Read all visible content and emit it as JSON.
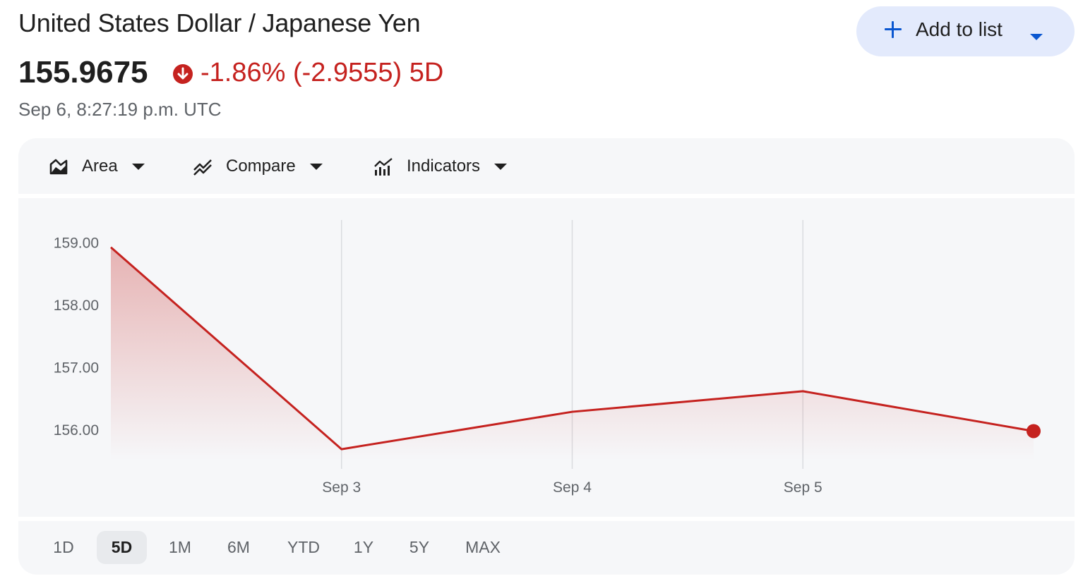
{
  "header": {
    "title": "United States Dollar / Japanese Yen",
    "price": "155.9675",
    "change": "-1.86% (-2.9555) 5D",
    "timestamp": "Sep 6, 8:27:19 p.m. UTC",
    "add_button_label": "Add to list",
    "change_color": "#c5221f",
    "change_icon": "arrow-down-circle-icon"
  },
  "toolbar": {
    "chart_type_label": "Area",
    "compare_label": "Compare",
    "indicators_label": "Indicators"
  },
  "ranges": [
    "1D",
    "5D",
    "1M",
    "6M",
    "YTD",
    "1Y",
    "5Y",
    "MAX"
  ],
  "active_range": "5D",
  "chart_data": {
    "type": "area",
    "title": "",
    "xlabel": "",
    "ylabel": "",
    "x_ticks": [
      "Sep 3",
      "Sep 4",
      "Sep 5"
    ],
    "y_ticks": [
      "159.00",
      "158.00",
      "157.00",
      "156.00"
    ],
    "ylim": [
      155.5,
      159.2
    ],
    "line_color": "#c5221f",
    "grid": "vertical",
    "series": [
      {
        "points": [
          {
            "x": "Sep 2",
            "y": 158.92
          },
          {
            "x": "Sep 3",
            "y": 155.68
          },
          {
            "x": "Sep 4",
            "y": 156.28
          },
          {
            "x": "Sep 5",
            "y": 156.61
          },
          {
            "x": "Sep 6",
            "y": 155.97
          }
        ]
      }
    ]
  }
}
